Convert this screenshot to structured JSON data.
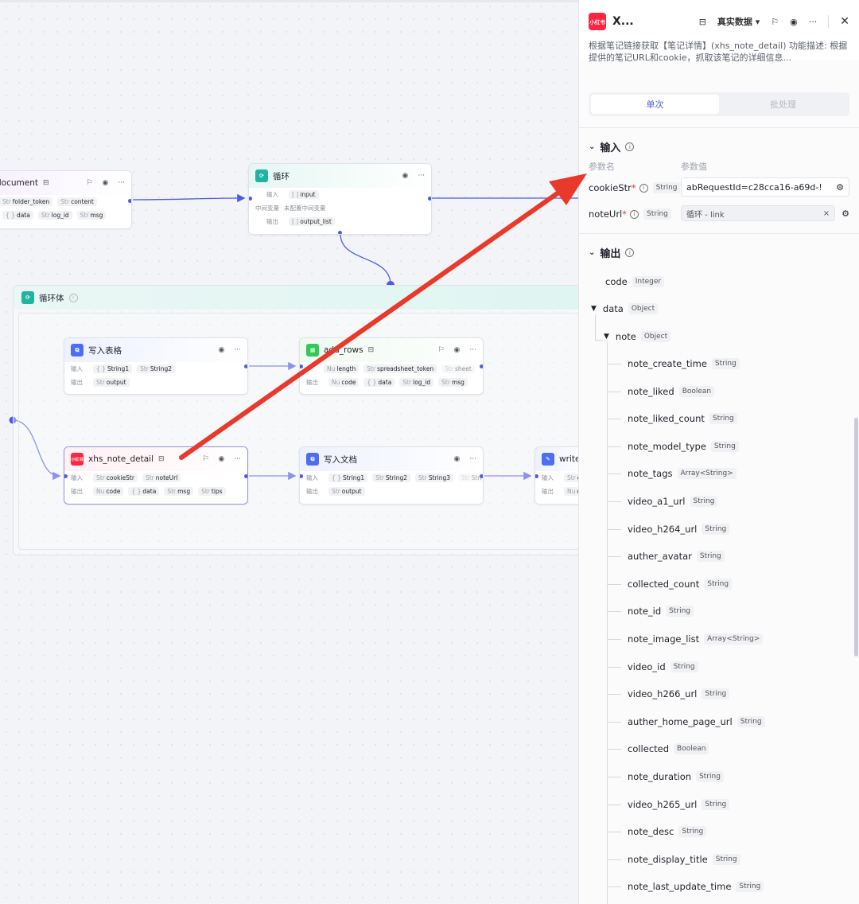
{
  "canvas": {
    "node_document": {
      "title": "document",
      "inputs": [
        {
          "t": "Str",
          "n": "folder_token"
        },
        {
          "t": "Str",
          "n": "content"
        }
      ],
      "outputs": [
        {
          "t": "{ }",
          "n": "data"
        },
        {
          "t": "Str",
          "n": "log_id"
        },
        {
          "t": "Str",
          "n": "msg"
        }
      ]
    },
    "node_loop": {
      "title": "循环",
      "in_label": "输入",
      "in_chip": {
        "t": "[ ]",
        "n": "input"
      },
      "mid_label": "中间变量",
      "mid_text": "未配置中间变量",
      "out_label": "输出",
      "out_chip": {
        "t": "[ ]",
        "n": "output_list"
      }
    },
    "loop_body": {
      "title": "循环体"
    },
    "node_sheet": {
      "title": "写入表格",
      "in_label": "输入",
      "out_label": "输出",
      "inputs": [
        {
          "t": "{ }",
          "n": "String1"
        },
        {
          "t": "Str",
          "n": "String2"
        }
      ],
      "outputs": [
        {
          "t": "Str",
          "n": "output"
        }
      ]
    },
    "node_rows": {
      "title": "add_rows",
      "in_label": "输入",
      "out_label": "输出",
      "inputs": [
        {
          "t": "Nu",
          "n": "length"
        },
        {
          "t": "Str",
          "n": "spreadsheet_token"
        },
        {
          "t": "Str",
          "n": "sheet"
        }
      ],
      "outputs": [
        {
          "t": "Nu",
          "n": "code"
        },
        {
          "t": "{ }",
          "n": "data"
        },
        {
          "t": "Str",
          "n": "log_id"
        },
        {
          "t": "Str",
          "n": "msg"
        }
      ]
    },
    "node_xhs": {
      "title": "xhs_note_detail",
      "icon": "小红书",
      "in_label": "输入",
      "out_label": "输出",
      "inputs": [
        {
          "t": "Str",
          "n": "cookieStr"
        },
        {
          "t": "Str",
          "n": "noteUrl"
        }
      ],
      "outputs": [
        {
          "t": "Nu",
          "n": "code"
        },
        {
          "t": "{ }",
          "n": "data"
        },
        {
          "t": "Str",
          "n": "msg"
        },
        {
          "t": "Str",
          "n": "tips"
        }
      ]
    },
    "node_doc": {
      "title": "写入文档",
      "in_label": "输入",
      "out_label": "输出",
      "inputs": [
        {
          "t": "{ }",
          "n": "String1"
        },
        {
          "t": "Str",
          "n": "String2"
        },
        {
          "t": "Str",
          "n": "String3"
        },
        {
          "t": "Str",
          "n": "Stri"
        }
      ],
      "outputs": [
        {
          "t": "Str",
          "n": "output"
        }
      ]
    },
    "node_write": {
      "title": "write_",
      "in_label": "输入",
      "out_label": "输出",
      "inputs": [
        {
          "t": "Str",
          "n": "con"
        }
      ],
      "outputs": [
        {
          "t": "Nu",
          "n": "cod"
        }
      ]
    }
  },
  "panel": {
    "app_icon_text": "小红书",
    "title": "X...",
    "mode_label": "真实数据",
    "description": "根据笔记链接获取【笔记详情】(xhs_note_detail) 功能描述: 根据提供的笔记URL和cookie，抓取该笔记的详细信息...",
    "tabs": [
      "单次",
      "批处理"
    ],
    "input_section": "输入",
    "col_name": "参数名",
    "col_value": "参数值",
    "params": [
      {
        "name": "cookieStr",
        "required": "*",
        "type": "String",
        "value": "abRequestId=c28cca16-a69d-!"
      },
      {
        "name": "noteUrl",
        "required": "*",
        "type": "String",
        "value": "循环 - link"
      }
    ],
    "output_section": "输出",
    "outputs_top": [
      {
        "name": "code",
        "type": "Integer"
      },
      {
        "name": "data",
        "type": "Object"
      },
      {
        "name": "note",
        "type": "Object"
      }
    ],
    "note_fields": [
      {
        "name": "note_create_time",
        "type": "String"
      },
      {
        "name": "note_liked",
        "type": "Boolean"
      },
      {
        "name": "note_liked_count",
        "type": "String"
      },
      {
        "name": "note_model_type",
        "type": "String"
      },
      {
        "name": "note_tags",
        "type": "Array<String>"
      },
      {
        "name": "video_a1_url",
        "type": "String"
      },
      {
        "name": "video_h264_url",
        "type": "String"
      },
      {
        "name": "auther_avatar",
        "type": "String"
      },
      {
        "name": "collected_count",
        "type": "String"
      },
      {
        "name": "note_id",
        "type": "String"
      },
      {
        "name": "note_image_list",
        "type": "Array<String>"
      },
      {
        "name": "video_id",
        "type": "String"
      },
      {
        "name": "video_h266_url",
        "type": "String"
      },
      {
        "name": "auther_home_page_url",
        "type": "String"
      },
      {
        "name": "collected",
        "type": "Boolean"
      },
      {
        "name": "note_duration",
        "type": "String"
      },
      {
        "name": "video_h265_url",
        "type": "String"
      },
      {
        "name": "note_desc",
        "type": "String"
      },
      {
        "name": "note_display_title",
        "type": "String"
      },
      {
        "name": "note_last_update_time",
        "type": "String"
      }
    ]
  },
  "icons": {
    "loop": "loop-icon",
    "plugin": "plugin-icon",
    "sheet": "sheet-icon",
    "close": "close-icon"
  },
  "colors": {
    "accent": "#4e5ae8",
    "arrow": "#e8392b",
    "xhs_red": "#ff2442",
    "loop_green": "#1fb3a0"
  }
}
